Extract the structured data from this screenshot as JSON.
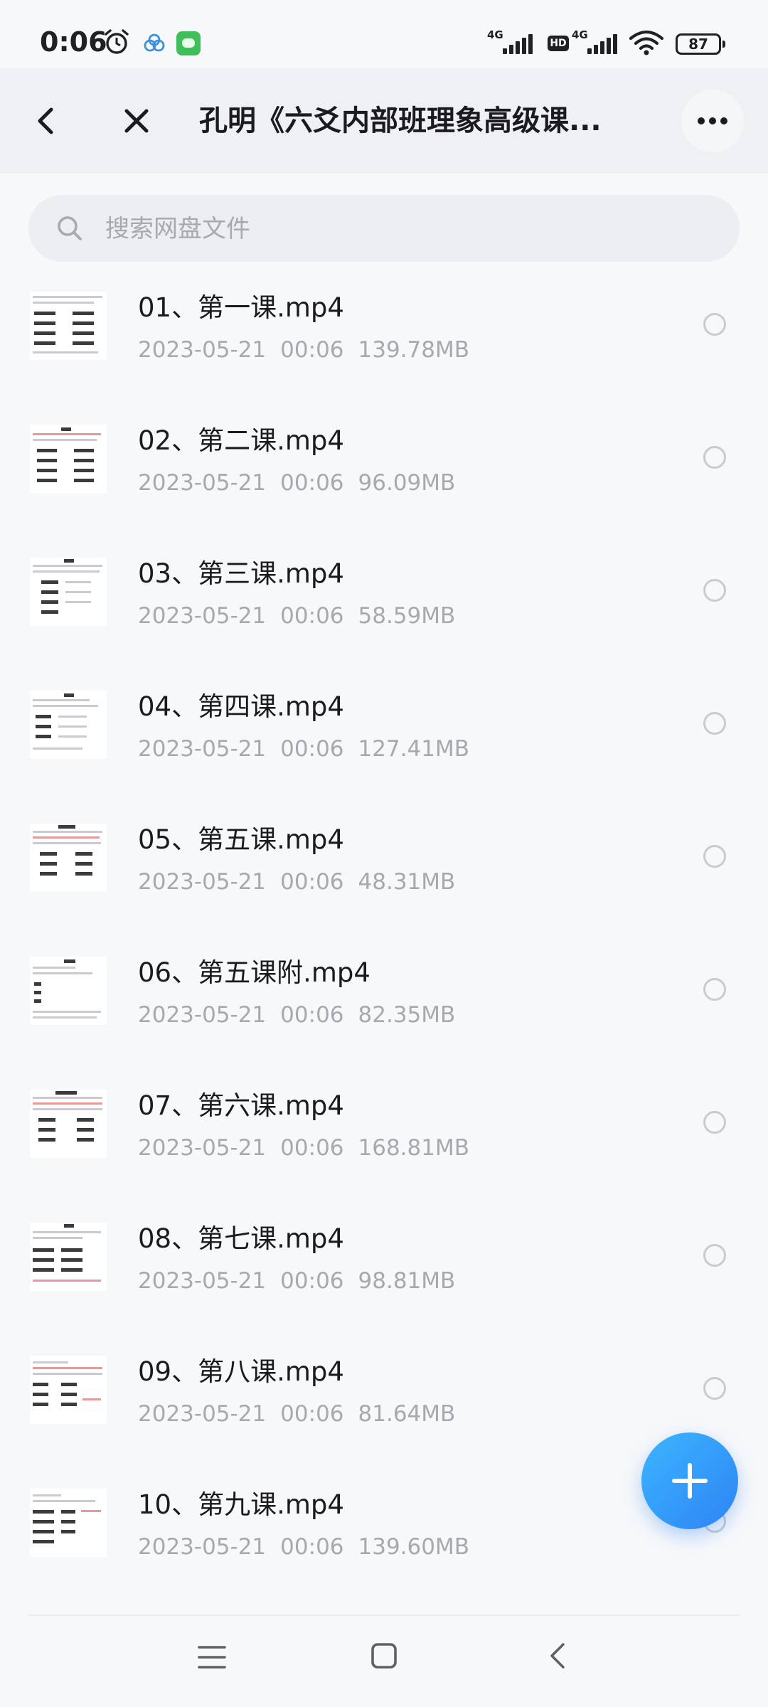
{
  "status_bar": {
    "time": "0:06",
    "network_1": "4G",
    "network_2": "4G",
    "hd": "HD",
    "battery": "87",
    "icons": [
      "alarm-icon",
      "cloud-icon",
      "app-notification-icon",
      "signal-icon",
      "hd-icon",
      "signal-icon",
      "wifi-icon",
      "battery-icon"
    ]
  },
  "header": {
    "title": "孔明《六爻内部班理象高级课...",
    "back_icon": "chevron-left-icon",
    "close_icon": "close-icon",
    "more_icon": "more-horizontal-icon"
  },
  "search": {
    "placeholder": "搜索网盘文件",
    "value": "",
    "icon": "search-icon"
  },
  "files": [
    {
      "name": "01、第一课.mp4",
      "date": "2023-05-21",
      "time": "00:06",
      "size": "139.78MB"
    },
    {
      "name": "02、第二课.mp4",
      "date": "2023-05-21",
      "time": "00:06",
      "size": "96.09MB"
    },
    {
      "name": "03、第三课.mp4",
      "date": "2023-05-21",
      "time": "00:06",
      "size": "58.59MB"
    },
    {
      "name": "04、第四课.mp4",
      "date": "2023-05-21",
      "time": "00:06",
      "size": "127.41MB"
    },
    {
      "name": "05、第五课.mp4",
      "date": "2023-05-21",
      "time": "00:06",
      "size": "48.31MB"
    },
    {
      "name": "06、第五课附.mp4",
      "date": "2023-05-21",
      "time": "00:06",
      "size": "82.35MB"
    },
    {
      "name": "07、第六课.mp4",
      "date": "2023-05-21",
      "time": "00:06",
      "size": "168.81MB"
    },
    {
      "name": "08、第七课.mp4",
      "date": "2023-05-21",
      "time": "00:06",
      "size": "98.81MB"
    },
    {
      "name": "09、第八课.mp4",
      "date": "2023-05-21",
      "time": "00:06",
      "size": "81.64MB"
    },
    {
      "name": "10、第九课.mp4",
      "date": "2023-05-21",
      "time": "00:06",
      "size": "139.60MB"
    }
  ],
  "fab": {
    "icon": "plus-icon"
  },
  "nav": {
    "icons": [
      "menu-icon",
      "home-icon",
      "back-icon"
    ]
  },
  "colors": {
    "accent": "#2f83f5",
    "text_primary": "#1b1b1f",
    "text_secondary": "#a7a9af",
    "header_bg": "#eef0f4",
    "page_bg": "#f7f8fa"
  }
}
